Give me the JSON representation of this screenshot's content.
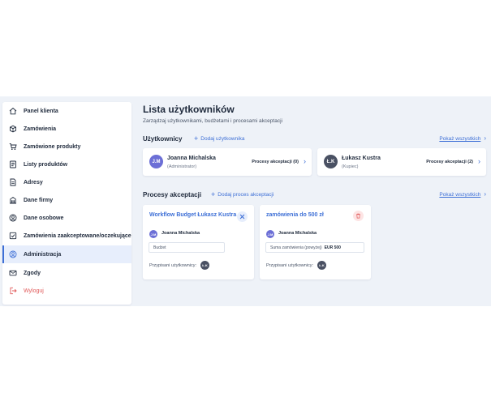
{
  "colors": {
    "accent": "#3d6fd6",
    "danger": "#e05a5a",
    "avatar_purple": "#6c6fd6",
    "avatar_dark": "#4a5163",
    "background": "#eef2f8"
  },
  "sidebar": {
    "items": [
      {
        "label": "Panel klienta",
        "icon": "home-icon"
      },
      {
        "label": "Zamówienia",
        "icon": "box-icon"
      },
      {
        "label": "Zamówione produkty",
        "icon": "cart-icon"
      },
      {
        "label": "Listy produktów",
        "icon": "list-icon"
      },
      {
        "label": "Adresy",
        "icon": "document-icon"
      },
      {
        "label": "Dane firmy",
        "icon": "building-icon"
      },
      {
        "label": "Dane osobowe",
        "icon": "person-icon"
      },
      {
        "label": "Zamówienia zaakceptowane/oczekujące",
        "icon": "checkbox-icon"
      },
      {
        "label": "Administracja",
        "icon": "admin-icon",
        "active": true
      },
      {
        "label": "Zgody",
        "icon": "mail-icon"
      },
      {
        "label": "Wyloguj",
        "icon": "logout-icon"
      }
    ]
  },
  "header": {
    "title": "Lista użytkowników",
    "subtitle": "Zarządzaj użytkownikami, budżetami i procesami akceptacji"
  },
  "users_section": {
    "title": "Użytkownicy",
    "add_label": "Dodaj użytkownika",
    "show_all": "Pokaż wszystkich",
    "users": [
      {
        "initials": "J.M",
        "name": "Joanna Michalska",
        "role": "(Administrator)",
        "processes": "Procesy akceptacji (0)"
      },
      {
        "initials": "Ł.K",
        "name": "Łukasz Kustra",
        "role": "(Kupiec)",
        "processes": "Procesy akceptacji (2)"
      }
    ]
  },
  "processes_section": {
    "title": "Procesy akceptacji",
    "add_label": "Dodaj proces akceptacji",
    "show_all": "Pokaż wszystkich",
    "processes": [
      {
        "title": "Workflow Budget Łukasz Kustra",
        "action_icon": "close-icon",
        "user_initials": "J.M",
        "user_name": "Joanna Michalska",
        "field_text": "Budżet",
        "field_value": "",
        "assigned_label": "Przypisani użytkownicy:",
        "assigned_initials": "Ł.K"
      },
      {
        "title": "zamówienia do 500 zł",
        "action_icon": "trash-icon",
        "user_initials": "J.M",
        "user_name": "Joanna Michalska",
        "field_text": "Suma zamówienia (powyżej)",
        "field_value": "EUR 500",
        "assigned_label": "Przypisani użytkownicy:",
        "assigned_initials": "Ł.K"
      }
    ]
  }
}
